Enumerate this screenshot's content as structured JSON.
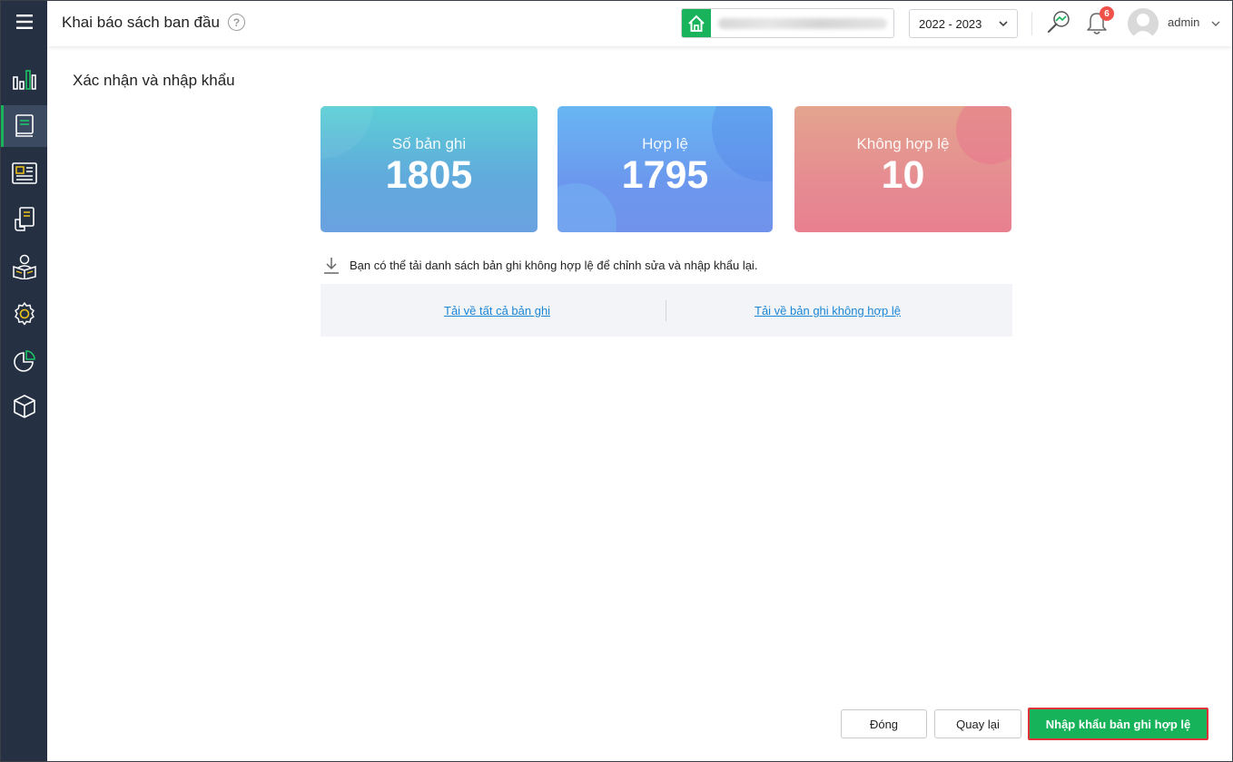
{
  "header": {
    "title": "Khai báo sách ban đầu",
    "year": "2022 - 2023",
    "notification_count": "6",
    "user_name": "admin"
  },
  "main": {
    "section_title": "Xác nhận và nhập khẩu",
    "stats": [
      {
        "label": "Số bản ghi",
        "value": "1805"
      },
      {
        "label": "Hợp lệ",
        "value": "1795"
      },
      {
        "label": "Không hợp lệ",
        "value": "10"
      }
    ],
    "hint": "Bạn có thể tải danh sách bản ghi không hợp lệ để chỉnh sửa và nhập khẩu lại.",
    "links": {
      "download_all": "Tải về tất cả bản ghi",
      "download_invalid": "Tải về bản ghi không hợp lệ"
    }
  },
  "footer": {
    "close_label": "Đóng",
    "back_label": "Quay lại",
    "import_label": "Nhập khẩu bản ghi hợp lệ"
  },
  "colors": {
    "sidebar": "#253043",
    "accent_green": "#19b35c",
    "link_blue": "#1a86d6",
    "badge_red": "#f0524a"
  },
  "icons": {
    "sidebar": [
      "menu-icon",
      "dashboard-chart-icon",
      "book-icon",
      "catalog-icon",
      "borrow-icon",
      "reader-icon",
      "settings-icon",
      "report-pie-icon",
      "package-icon"
    ],
    "header": [
      "help-icon",
      "school-home-icon",
      "chevron-down-icon",
      "search-stat-icon",
      "bell-icon",
      "avatar"
    ]
  }
}
